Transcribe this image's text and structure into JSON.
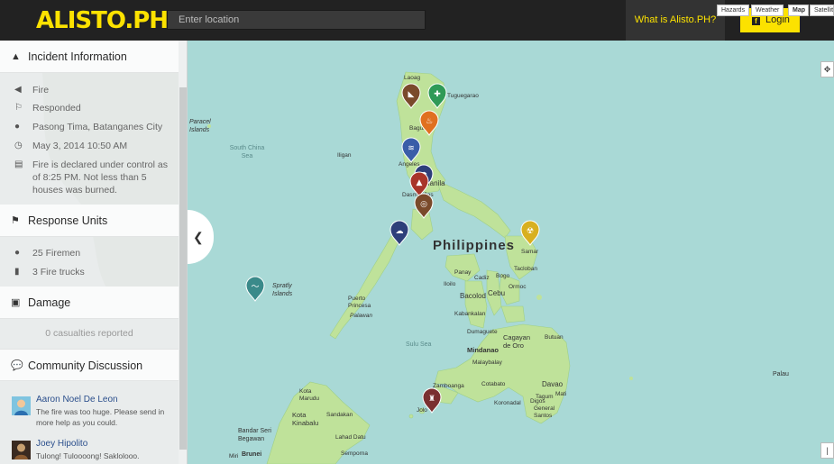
{
  "header": {
    "logo": "ALISTO.PH",
    "search_placeholder": "Enter location",
    "what_is": "What is Alisto.PH?",
    "login": "Login"
  },
  "incident": {
    "title": "Incident Information",
    "type": "Fire",
    "status": "Responded",
    "location": "Pasong Tima, Batanganes City",
    "datetime": "May 3, 2014 10:50 AM",
    "description": "Fire is declared under control as of 8:25 PM. Not less than 5 houses was burned."
  },
  "response": {
    "title": "Response Units",
    "firemen": "25 Firemen",
    "trucks": "3 Fire trucks"
  },
  "damage": {
    "title": "Damage",
    "casualties": "0 casualties reported"
  },
  "discussion": {
    "title": "Community Discussion",
    "comments": [
      {
        "name": "Aaron Noel De Leon",
        "text": "The fire was too huge. Please send in more help as you could."
      },
      {
        "name": "Joey Hipolito",
        "text": "Tulong! Tuloooong! Saklolooo."
      }
    ]
  },
  "map": {
    "types": [
      "Hazards",
      "Weather",
      "Map",
      "Satellite"
    ],
    "labels": {
      "philippines": "Philippines",
      "paracel": "Paracel Islands",
      "south_china_sea": "South China Sea",
      "spratly": "Spratly Islands",
      "laoag": "Laoag",
      "angeles": "Angeles",
      "manila": "Manila",
      "dasmarinas": "Dasmariñas",
      "puerto_princesa": "Puerto Princesa",
      "palawan": "Palawan",
      "sulu_sea": "Sulu Sea",
      "mindanao": "Mindanao",
      "zamboanga": "Zamboanga",
      "jolo": "Jolo",
      "davao": "Davao",
      "palau": "Palau",
      "kota_kinabalu": "Kota Kinabalu",
      "sandakan": "Sandakan",
      "bandar": "Bandar Seri Begawan",
      "brunei": "Brunei",
      "cebu": "Cebu",
      "bacolod": "Bacolod",
      "iloilo": "Iloilo",
      "tacloban": "Tacloban",
      "cagayan": "Cagayan de Oro",
      "butuan": "Butuan",
      "tagum": "Tagum",
      "digos": "Digos",
      "mati": "Mati",
      "koronadal": "Koronadal",
      "cotabato": "Cotabato",
      "dumaguete": "Dumaguete",
      "kabankalan": "Kabankalan",
      "panay": "Panay",
      "cadiz": "Cadiz",
      "ormoc": "Ormoc",
      "bogo": "Bogo",
      "lahad_datu": "Lahad Datu",
      "semporna": "Semporna",
      "kota_marudu": "Kota Marudu",
      "miri": "Miri",
      "samar": "Samar",
      "general_santos": "General Santos",
      "malaybalay": "Malaybalay",
      "iligan": "Iligan",
      "tuguegarao": "Tuguegarao",
      "baguio": "Baguio"
    },
    "markers": [
      {
        "name": "landslide",
        "color": "#7a4a2b",
        "glyph": "◣"
      },
      {
        "name": "health",
        "color": "#2f9a57",
        "glyph": "✚"
      },
      {
        "name": "fire",
        "color": "#e07020",
        "glyph": "♨"
      },
      {
        "name": "flood",
        "color": "#3a5da8",
        "glyph": "≋"
      },
      {
        "name": "rain",
        "color": "#2e3f7a",
        "glyph": "☂"
      },
      {
        "name": "volcano",
        "color": "#a8352a",
        "glyph": "▲"
      },
      {
        "name": "earthquake",
        "color": "#7a4a2b",
        "glyph": "◎"
      },
      {
        "name": "storm",
        "color": "#2e3f7a",
        "glyph": "☁"
      },
      {
        "name": "radiation",
        "color": "#d8b020",
        "glyph": "☢"
      },
      {
        "name": "sea-wave",
        "color": "#3a8a8a",
        "glyph": "〜"
      },
      {
        "name": "fire-2",
        "color": "#7a3030",
        "glyph": "♜"
      }
    ]
  }
}
